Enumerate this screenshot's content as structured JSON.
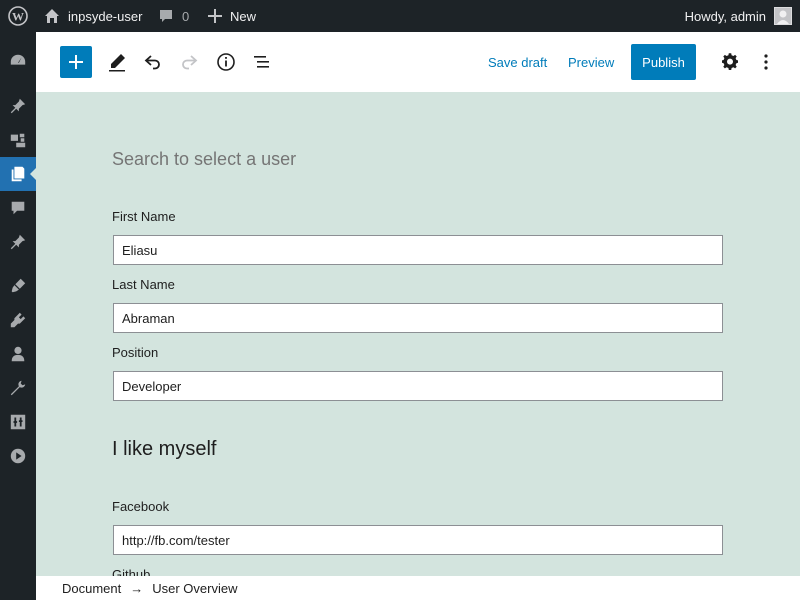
{
  "admin_bar": {
    "site_name": "inpsyde-user",
    "comments_count": "0",
    "new_label": "New",
    "howdy": "Howdy, admin"
  },
  "sidebar": {
    "items": [
      "dashboard-icon",
      "pin-icon",
      "media-icon",
      "pages-icon",
      "comments-icon",
      "pin-icon",
      "appearance-icon",
      "plugins-icon",
      "users-icon",
      "tools-icon",
      "settings-icon",
      "play-icon"
    ],
    "active_index": 3
  },
  "toolbar": {
    "save_draft": "Save draft",
    "preview": "Preview",
    "publish": "Publish"
  },
  "editor": {
    "search_heading": "Search to select a user",
    "first_name_label": "First Name",
    "first_name_value": "Eliasu",
    "last_name_label": "Last Name",
    "last_name_value": "Abraman",
    "position_label": "Position",
    "position_value": "Developer",
    "section_heading": "I like myself",
    "facebook_label": "Facebook",
    "facebook_value": "http://fb.com/tester",
    "github_label": "Github"
  },
  "breadcrumb": {
    "root": "Document",
    "separator": "→",
    "current": "User Overview"
  },
  "colors": {
    "admin_bar": "#1d2327",
    "accent": "#007cba",
    "canvas": "#d3e4de"
  }
}
